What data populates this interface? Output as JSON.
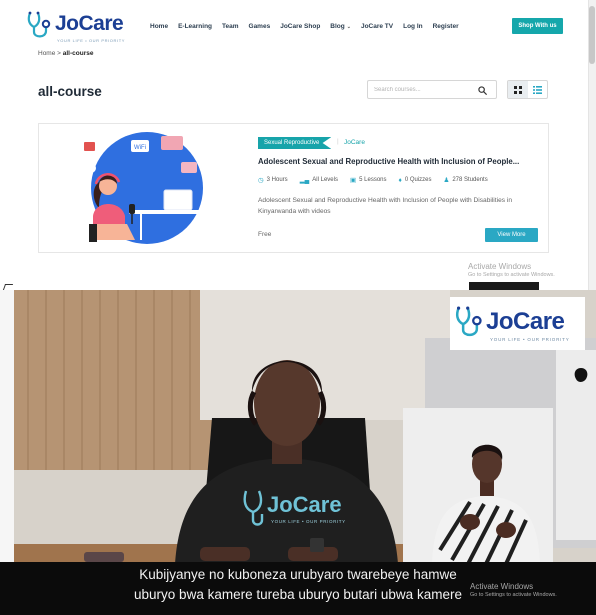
{
  "brand": {
    "name": "JoCare",
    "tagline": "YOUR LIFE • OUR PRIORITY"
  },
  "nav": {
    "items": [
      "Home",
      "E-Learning",
      "Team",
      "Games",
      "JoCare Shop",
      "Blog",
      "JoCare TV",
      "Log In",
      "Register"
    ],
    "shop_button": "Shop With us"
  },
  "breadcrumb": {
    "home": "Home",
    "separator": ">",
    "current": "all-course"
  },
  "page_title": "all-course",
  "search": {
    "placeholder": "Search courses..."
  },
  "course": {
    "category": "Sexual Reproductive",
    "separator": "|",
    "author": "JoCare",
    "title": "Adolescent Sexual and Reproductive Health with Inclusion of People...",
    "meta": {
      "duration": "3 Hours",
      "level": "All Levels",
      "lessons": "5 Lessons",
      "quizzes": "0 Quizzes",
      "students": "278 Students"
    },
    "description": "Adolescent Sexual and Reproductive Health with Inclusion of People with Disabilities in Kinyarwanda with videos",
    "price": "Free",
    "view_more": "View More"
  },
  "watermark": {
    "title": "Activate Windows",
    "subtitle": "Go to Settings to activate Windows."
  },
  "video": {
    "logo_name": "JoCare",
    "logo_tagline": "YOUR LIFE • OUR PRIORITY",
    "shirt_text": "JoCare",
    "shirt_tagline": "YOUR LIFE • OUR PRIORITY",
    "subtitle_line1": "Kubijyanye no kuboneza urubyaro twarebeye hamwe",
    "subtitle_line2": "uburyo bwa kamere tureba uburyo butari ubwa kamere"
  },
  "colors": {
    "teal": "#15a7ab",
    "brand_blue": "#1c3f94",
    "accent_cyan": "#2aa8c4"
  }
}
